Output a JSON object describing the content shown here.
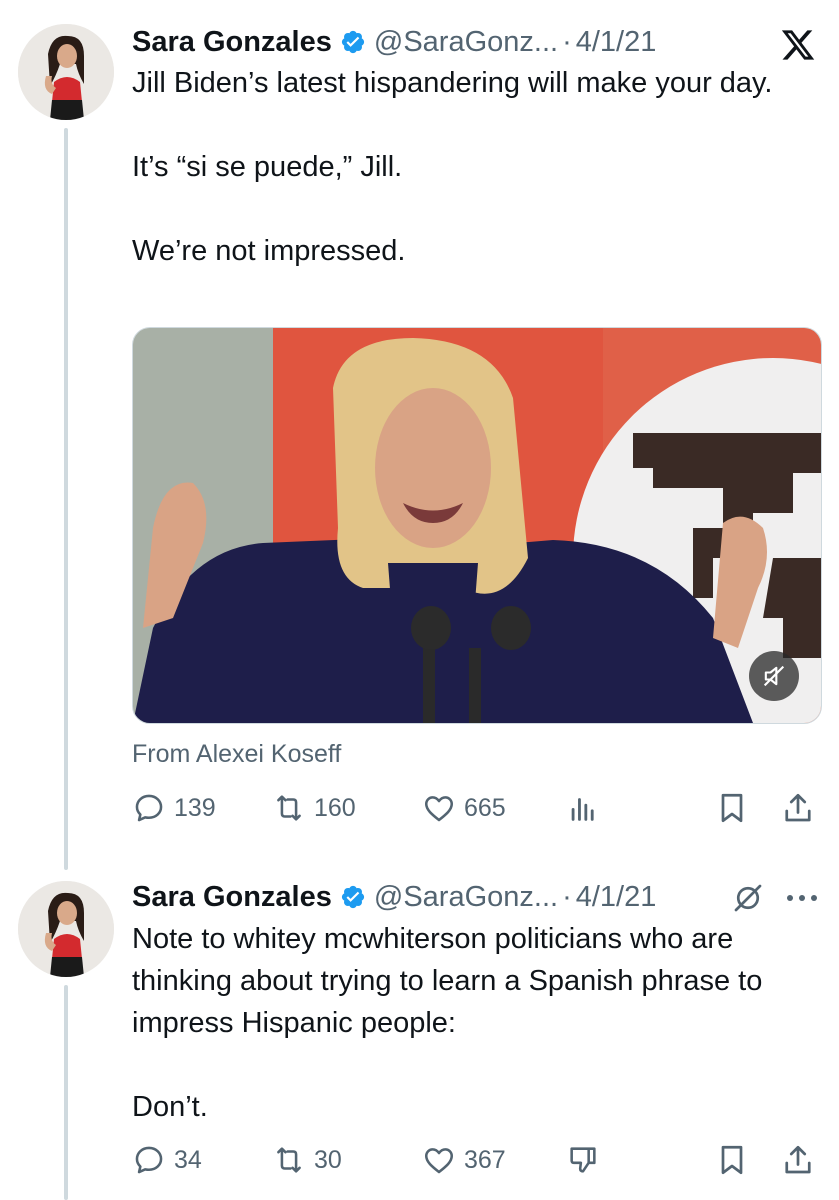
{
  "tweet1": {
    "author_name": "Sara Gonzales",
    "handle": "@SaraGonz...",
    "separator": "·",
    "date": "4/1/21",
    "text_lines": [
      "Jill Biden’s latest hispandering will make your day.",
      "It’s “si se puede,” Jill.",
      "We’re not impressed."
    ],
    "media_attribution": "From Alexei Koseff",
    "replies": "139",
    "retweets": "160",
    "likes": "665"
  },
  "tweet2": {
    "author_name": "Sara Gonzales",
    "handle": "@SaraGonz...",
    "separator": "·",
    "date": "4/1/21",
    "text_lines": [
      "Note to whitey mcwhiterson politicians who are thinking about trying to learn a Spanish phrase to impress Hispanic people:",
      "Don’t."
    ],
    "replies": "34",
    "retweets": "30",
    "likes": "367"
  },
  "colors": {
    "text": "#0f1419",
    "muted": "#536471",
    "verified": "#1d9bf0",
    "thread_line": "#cfd9de"
  },
  "icons": {
    "verified": "verified-badge-icon",
    "x_logo": "x-logo-icon",
    "reply": "reply-icon",
    "retweet": "retweet-icon",
    "like": "heart-icon",
    "views": "views-icon",
    "bookmark": "bookmark-icon",
    "share": "share-icon",
    "grok": "grok-icon",
    "more": "more-icon",
    "downvote": "downvote-icon",
    "mute": "mute-icon"
  }
}
